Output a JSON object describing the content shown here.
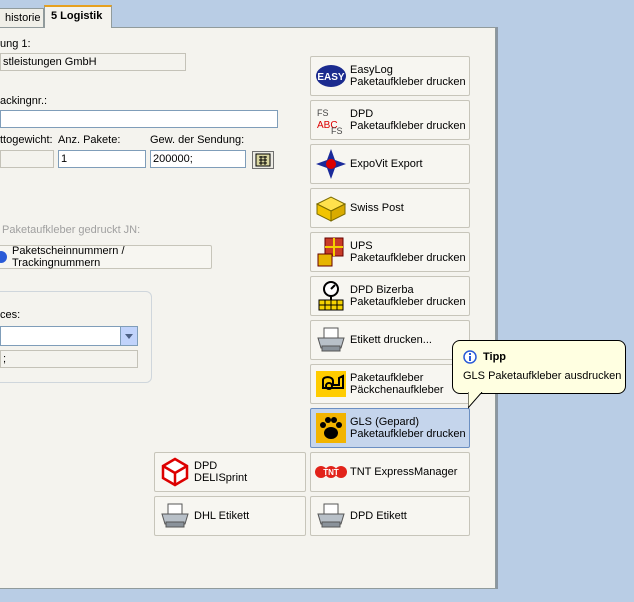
{
  "tabs": [
    {
      "label": "historie",
      "active": false
    },
    {
      "label": "5 Logistik",
      "active": true
    }
  ],
  "form": {
    "label_row1": "ung 1:",
    "company_value": "stleistungen GmbH",
    "label_tracking": "ackingnr.:",
    "tracking_value": "",
    "label_weight": "ttogewicht:",
    "weight_value": "",
    "label_packages": "Anz. Pakete:",
    "packages_value": "1",
    "label_shipment_weight": "Gew. der Sendung:",
    "shipment_weight_value": "200000;",
    "label_printed": "Paketaufkleber gedruckt JN:",
    "tracking_numbers_button": "Paketscheinnummern / Trackingnummern",
    "label_services": "ces:",
    "services_select_value": "",
    "services_list_value": ";"
  },
  "carrier_buttons": {
    "easylog": {
      "line1": "EasyLog",
      "line2": "Paketaufkleber drucken"
    },
    "dpd": {
      "line1": "DPD",
      "line2": "Paketaufkleber drucken"
    },
    "expovit": {
      "line1": "ExpoVit Export",
      "line2": ""
    },
    "swisspost": {
      "line1": "Swiss Post",
      "line2": ""
    },
    "ups": {
      "line1": "UPS",
      "line2": "Paketaufkleber drucken"
    },
    "dpd_bizerba": {
      "line1": "DPD Bizerba",
      "line2": "Paketaufkleber drucken"
    },
    "etikett": {
      "line1": "Etikett drucken...",
      "line2": ""
    },
    "post": {
      "line1": "Paketaufkleber",
      "line2": "Päckchenaufkleber"
    },
    "gls": {
      "line1": "GLS (Gepard)",
      "line2": "Paketaufkleber drucken"
    },
    "dpd_delisprint": {
      "line1": "DPD",
      "line2": "DELISprint"
    },
    "tnt": {
      "line1": "TNT ExpressManager",
      "line2": ""
    },
    "dhl_etikett": {
      "line1": "DHL Etikett",
      "line2": ""
    },
    "dpd_etikett": {
      "line1": "DPD Etikett",
      "line2": ""
    }
  },
  "tooltip": {
    "title": "Tipp",
    "text": "GLS Paketaufkleber ausdrucken"
  },
  "icon_text": {
    "easylog": "EASY",
    "dpd_fs": "FS",
    "dpd_abc": "ABC",
    "tnt": "TNT"
  },
  "colors": {
    "accent_tab": "#e6a01f",
    "highlight": "#c5d5ec",
    "tooltip_bg": "#ffffe1"
  }
}
